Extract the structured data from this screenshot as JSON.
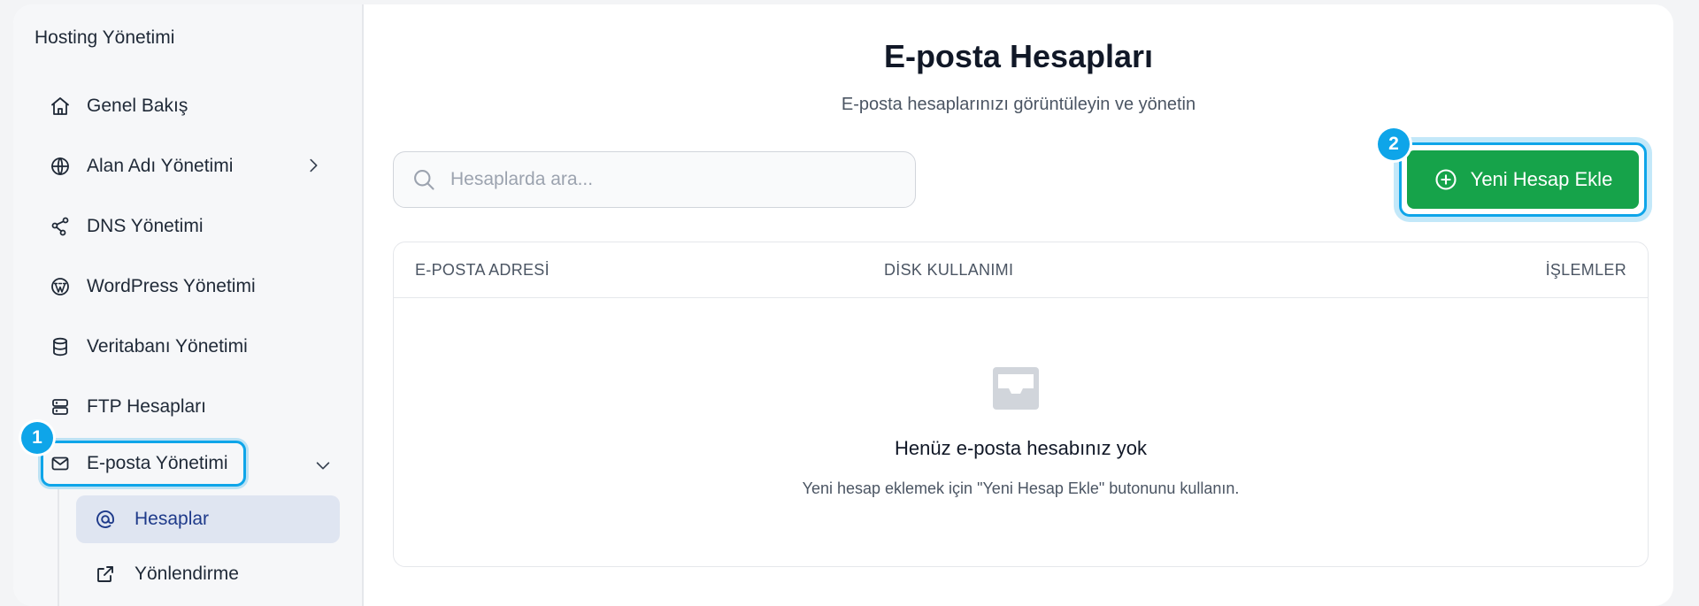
{
  "sidebar": {
    "title": "Hosting Yönetimi",
    "items": [
      {
        "label": "Genel Bakış",
        "icon": "home-icon"
      },
      {
        "label": "Alan Adı Yönetimi",
        "icon": "globe-icon"
      },
      {
        "label": "DNS Yönetimi",
        "icon": "share-nodes-icon"
      },
      {
        "label": "WordPress Yönetimi",
        "icon": "wordpress-icon"
      },
      {
        "label": "Veritabanı Yönetimi",
        "icon": "database-icon"
      },
      {
        "label": "FTP Hesapları",
        "icon": "server-icon"
      },
      {
        "label": "E-posta Yönetimi",
        "icon": "mail-icon"
      }
    ],
    "sub_items": [
      {
        "label": "Hesaplar",
        "icon": "at-sign-icon",
        "active": true
      },
      {
        "label": "Yönlendirme",
        "icon": "forward-icon",
        "active": false
      }
    ]
  },
  "badges": {
    "one": "1",
    "two": "2"
  },
  "main": {
    "title": "E-posta Hesapları",
    "subtitle": "E-posta hesaplarınızı görüntüleyin ve yönetin",
    "search_placeholder": "Hesaplarda ara...",
    "add_button_label": "Yeni Hesap Ekle",
    "table": {
      "columns": [
        "E-POSTA ADRESİ",
        "DİSK KULLANIMI",
        "İŞLEMLER"
      ],
      "empty_title": "Henüz e-posta hesabınız yok",
      "empty_description": "Yeni hesap eklemek için \"Yeni Hesap Ekle\" butonunu kullanın."
    }
  },
  "colors": {
    "accent": "#16a34a",
    "highlight": "#0ea5e9",
    "active_nav_bg": "#dfe5f1"
  }
}
